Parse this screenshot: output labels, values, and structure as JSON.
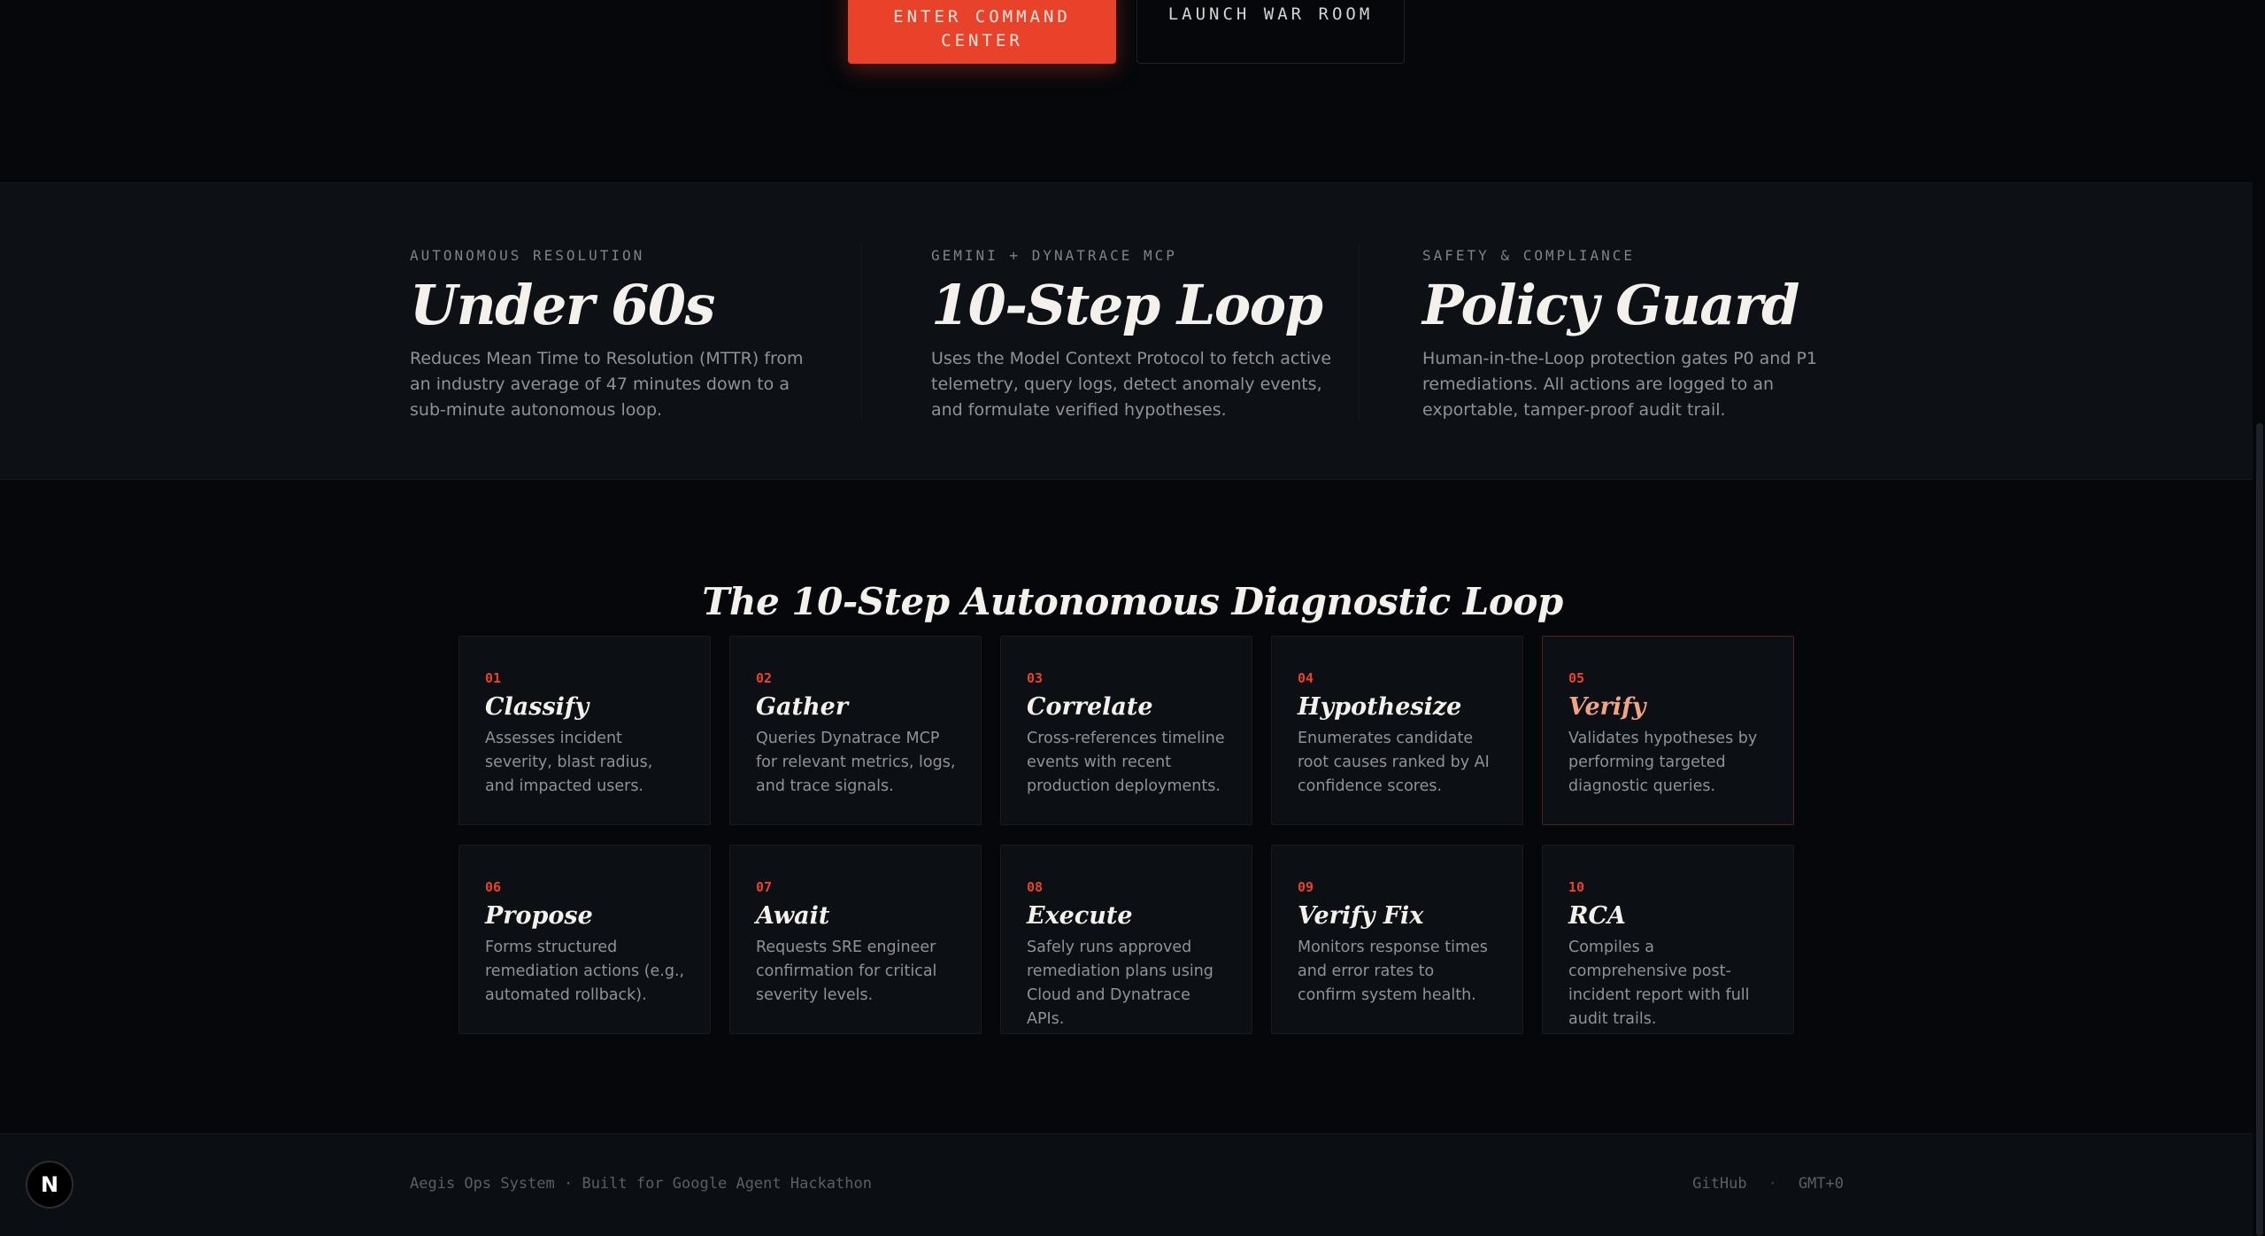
{
  "hero": {
    "primary_button_label": "ENTER COMMAND CENTER",
    "secondary_button_label": "LAUNCH WAR ROOM"
  },
  "stats": [
    {
      "eyebrow": "AUTONOMOUS RESOLUTION",
      "value": "Under 60s",
      "description": "Reduces Mean Time to Resolution (MTTR) from an industry average of 47 minutes down to a sub-minute autonomous loop."
    },
    {
      "eyebrow": "GEMINI + DYNATRACE MCP",
      "value": "10-Step Loop",
      "description": "Uses the Model Context Protocol to fetch active telemetry, query logs, detect anomaly events, and formulate verified hypotheses."
    },
    {
      "eyebrow": "SAFETY & COMPLIANCE",
      "value": "Policy Guard",
      "description": "Human-in-the-Loop protection gates P0 and P1 remediations. All actions are logged to an exportable, tamper-proof audit trail."
    }
  ],
  "loop": {
    "title": "The 10-Step Autonomous Diagnostic Loop",
    "steps": [
      {
        "num": "01",
        "title": "Classify",
        "desc": "Assesses incident severity, blast radius, and impacted users."
      },
      {
        "num": "02",
        "title": "Gather",
        "desc": "Queries Dynatrace MCP for relevant metrics, logs, and trace signals."
      },
      {
        "num": "03",
        "title": "Correlate",
        "desc": "Cross-references timeline events with recent production deployments."
      },
      {
        "num": "04",
        "title": "Hypothesize",
        "desc": "Enumerates candidate root causes ranked by AI confidence scores."
      },
      {
        "num": "05",
        "title": "Verify",
        "desc": "Validates hypotheses by performing targeted diagnostic queries."
      },
      {
        "num": "06",
        "title": "Propose",
        "desc": "Forms structured remediation actions (e.g., automated rollback)."
      },
      {
        "num": "07",
        "title": "Await",
        "desc": "Requests SRE engineer confirmation for critical severity levels."
      },
      {
        "num": "08",
        "title": "Execute",
        "desc": "Safely runs approved remediation plans using Cloud and Dynatrace APIs."
      },
      {
        "num": "09",
        "title": "Verify Fix",
        "desc": "Monitors response times and error rates to confirm system health."
      },
      {
        "num": "10",
        "title": "RCA",
        "desc": "Compiles a comprehensive post-incident report with full audit trails."
      }
    ]
  },
  "footer": {
    "left_text": "Aegis Ops System · Built for Google Agent Hackathon",
    "github_label": "GitHub",
    "separator": "·",
    "timezone": "GMT+0"
  },
  "badge": {
    "label": "N"
  },
  "colors": {
    "accent": "#e8432a",
    "background": "#05070a",
    "panel": "#0d1014"
  }
}
